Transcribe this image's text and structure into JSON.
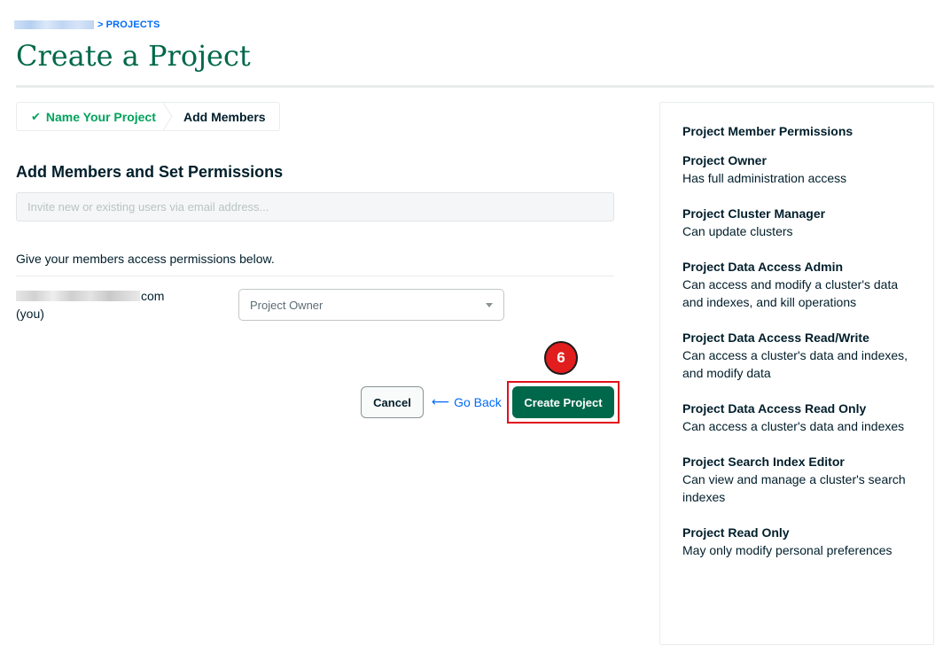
{
  "breadcrumb": {
    "separator": ">",
    "current": "PROJECTS"
  },
  "page": {
    "title": "Create a Project"
  },
  "stepper": {
    "steps": [
      {
        "label": "Name Your Project",
        "status": "complete"
      },
      {
        "label": "Add Members",
        "status": "active"
      }
    ]
  },
  "section": {
    "title": "Add Members and Set Permissions",
    "invite_placeholder": "Invite new or existing users via email address...",
    "permissions_description": "Give your members access permissions below."
  },
  "member": {
    "email_suffix": "com",
    "you_label": "(you)",
    "role": "Project Owner"
  },
  "step_badge": "6",
  "actions": {
    "cancel": "Cancel",
    "go_back": "Go Back",
    "create": "Create Project"
  },
  "side_panel": {
    "title": "Project Member Permissions",
    "roles": [
      {
        "name": "Project Owner",
        "description": "Has full administration access"
      },
      {
        "name": "Project Cluster Manager",
        "description": "Can update clusters"
      },
      {
        "name": "Project Data Access Admin",
        "description": "Can access and modify a cluster's data and indexes, and kill operations"
      },
      {
        "name": "Project Data Access Read/Write",
        "description": "Can access a cluster's data and indexes, and modify data"
      },
      {
        "name": "Project Data Access Read Only",
        "description": "Can access a cluster's data and indexes"
      },
      {
        "name": "Project Search Index Editor",
        "description": "Can view and manage a cluster's search indexes"
      },
      {
        "name": "Project Read Only",
        "description": "May only modify personal preferences"
      }
    ]
  },
  "colors": {
    "brand_green": "#00684a",
    "success_green": "#00a35c",
    "link_blue": "#016bf8",
    "highlight_red": "#e0101b"
  },
  "icons": [
    "check-icon",
    "caret-down-icon",
    "arrow-left-icon"
  ]
}
